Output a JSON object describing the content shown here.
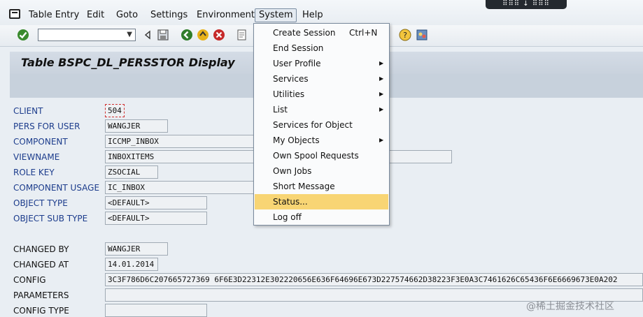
{
  "window": {
    "title": "Table BSPC_DL_PERSSTOR Display"
  },
  "menubar": {
    "items": [
      "Table Entry",
      "Edit",
      "Goto",
      "Settings",
      "Environment",
      "System",
      "Help"
    ]
  },
  "overlay_text": "⠿⠿⠿ ↓ ⠿⠿⠿",
  "toolbar": {
    "command_field_value": ""
  },
  "system_menu": {
    "items": [
      {
        "label": "Create Session",
        "shortcut": "Ctrl+N",
        "submenu": false
      },
      {
        "label": "End Session",
        "shortcut": "",
        "submenu": false
      },
      {
        "label": "User Profile",
        "shortcut": "",
        "submenu": true
      },
      {
        "label": "Services",
        "shortcut": "",
        "submenu": true
      },
      {
        "label": "Utilities",
        "shortcut": "",
        "submenu": true
      },
      {
        "label": "List",
        "shortcut": "",
        "submenu": true
      },
      {
        "label": "Services for Object",
        "shortcut": "",
        "submenu": false
      },
      {
        "label": "My Objects",
        "shortcut": "",
        "submenu": true
      },
      {
        "label": "Own Spool Requests",
        "shortcut": "",
        "submenu": false
      },
      {
        "label": "Own Jobs",
        "shortcut": "",
        "submenu": false
      },
      {
        "label": "Short Message",
        "shortcut": "",
        "submenu": false
      },
      {
        "label": "Status...",
        "shortcut": "",
        "submenu": false,
        "highlighted": true
      },
      {
        "label": "Log off",
        "shortcut": "",
        "submenu": false
      }
    ]
  },
  "form": {
    "fields": [
      {
        "label": "CLIENT",
        "value": "504"
      },
      {
        "label": "PERS FOR USER",
        "value": "WANGJER"
      },
      {
        "label": "COMPONENT",
        "value": "ICCMP_INBOX"
      },
      {
        "label": "VIEWNAME",
        "value": "INBOXITEMS"
      },
      {
        "label": "ROLE KEY",
        "value": "ZSOCIAL"
      },
      {
        "label": "COMPONENT USAGE",
        "value": "IC_INBOX"
      },
      {
        "label": "OBJECT TYPE",
        "value": "<DEFAULT>"
      },
      {
        "label": "OBJECT SUB TYPE",
        "value": "<DEFAULT>"
      },
      {
        "label": "CHANGED BY",
        "value": "WANGJER"
      },
      {
        "label": "CHANGED AT",
        "value": "14.01.2014"
      },
      {
        "label": "CONFIG",
        "value": "3C3F786D6C207665727369 6F6E3D22312E302220656E636F64696E673D227574662D38223F3E0A3C7461626C65436F6E6669673E0A202"
      },
      {
        "label": "PARAMETERS",
        "value": ""
      },
      {
        "label": "CONFIG TYPE",
        "value": ""
      }
    ]
  },
  "watermark": "@稀土掘金技术社区",
  "colors": {
    "highlight": "#f8d574",
    "label_blue": "#1c3c8c"
  }
}
